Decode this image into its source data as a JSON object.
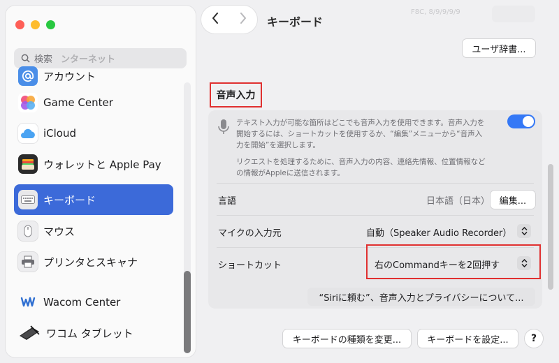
{
  "window": {
    "title": "キーボード",
    "top_faded_text": "F8C, 8/9/9/9/9"
  },
  "sidebar": {
    "search_placeholder": "検索",
    "search_overlap_text": "ンターネット",
    "items": [
      {
        "label": "アカウント",
        "icon": "at-sign-icon"
      },
      {
        "label": "Game Center",
        "icon": "game-center-icon"
      },
      {
        "label": "iCloud",
        "icon": "cloud-icon"
      },
      {
        "label": "ウォレットと Apple Pay",
        "icon": "wallet-icon"
      },
      {
        "label": "キーボード",
        "icon": "keyboard-icon",
        "active": true
      },
      {
        "label": "マウス",
        "icon": "mouse-icon"
      },
      {
        "label": "プリンタとスキャナ",
        "icon": "printer-icon"
      },
      {
        "label": "Wacom Center",
        "icon": "wacom-icon"
      },
      {
        "label": "ワコム タブレット",
        "icon": "tablet-icon"
      }
    ]
  },
  "main": {
    "user_dictionary_button": "ユーザ辞書...",
    "section_title": "音声入力",
    "description_1": "テキスト入力が可能な箇所はどこでも音声入力を使用できます。音声入力を開始するには、ショートカットを使用するか、“編集”メニューから“音声入力を開始”を選択します。",
    "description_2": "リクエストを処理するために、音声入力の内容、連絡先情報、位置情報などの情報がAppleに送信されます。",
    "dictation_enabled": true,
    "language_label": "言語",
    "language_value": "日本語（日本）",
    "language_edit_button": "編集...",
    "mic_label": "マイクの入力元",
    "mic_value": "自動（Speaker Audio Recorder）",
    "shortcut_label": "ショートカット",
    "shortcut_value": "右のCommandキーを2回押す",
    "siri_privacy_button": "“Siriに頼む”、音声入力とプライバシーについて...",
    "change_keyboard_type_button": "キーボードの種類を変更...",
    "setup_keyboard_button": "キーボードを設定...",
    "help_button": "?"
  },
  "colors": {
    "accent": "#3c6ad9",
    "toggle": "#3478f6",
    "highlight": "#e03030"
  }
}
